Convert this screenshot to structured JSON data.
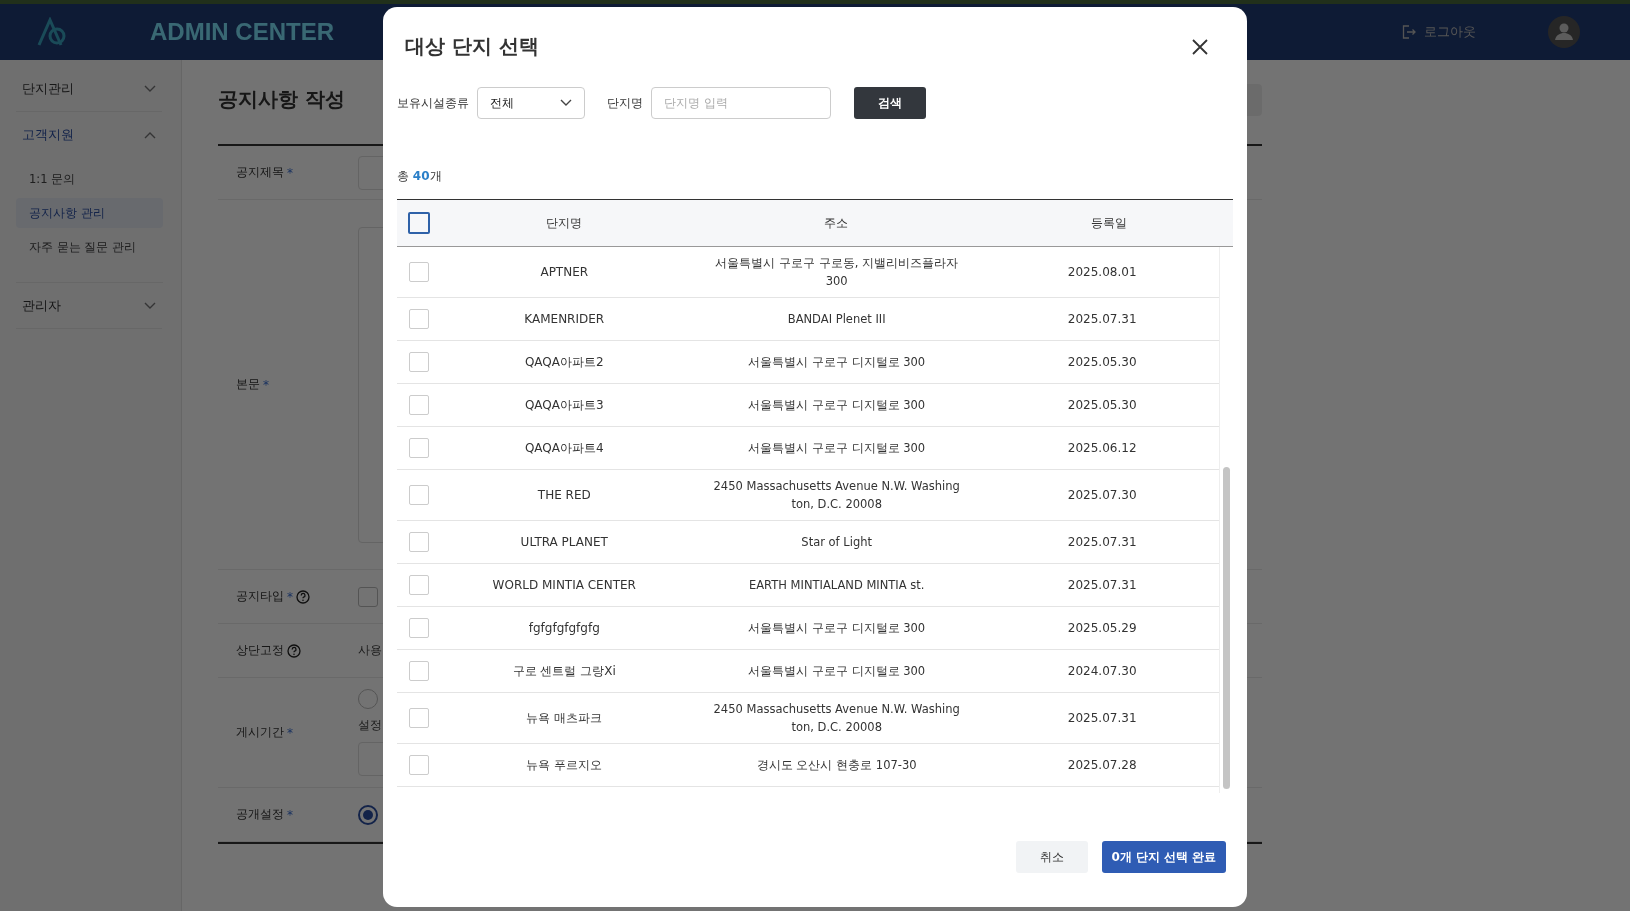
{
  "header": {
    "logo_text": "ADMIN CENTER",
    "logout": "로그아웃"
  },
  "sidebar": {
    "items": [
      {
        "label": "단지관리",
        "expanded": false
      },
      {
        "label": "고객지원",
        "expanded": true,
        "children": [
          {
            "label": "1:1 문의",
            "selected": false
          },
          {
            "label": "공지사항 관리",
            "selected": true
          },
          {
            "label": "자주 묻는 질문 관리",
            "selected": false
          }
        ]
      },
      {
        "label": "관리자",
        "expanded": false
      }
    ]
  },
  "page": {
    "title": "공지사항 작성",
    "fields": [
      {
        "label": "공지제목",
        "required_mark": "*",
        "help": false,
        "kind": "text"
      },
      {
        "label": "본문",
        "required_mark": "*",
        "help": false,
        "kind": "editor"
      },
      {
        "label": "공지타입",
        "required_mark": "*",
        "help": true,
        "kind": "checkbox",
        "checked": false
      },
      {
        "label": "상단고정",
        "help": true,
        "kind": "note",
        "value": "사용"
      },
      {
        "label": "게시기간",
        "required_mark": "*",
        "help": false,
        "kind": "period",
        "value": "설정",
        "selected": false
      },
      {
        "label": "공개설정",
        "required_mark": "*",
        "help": false,
        "kind": "radio",
        "selected": true
      }
    ]
  },
  "modal": {
    "title": "대상 단지 선택",
    "filters": {
      "facility_label": "보유시설종류",
      "facility_value": "전체",
      "name_label": "단지명",
      "name_placeholder": "단지명 입력",
      "search_button": "검색"
    },
    "total": {
      "prefix": "총",
      "count": "40",
      "suffix": "개"
    },
    "table": {
      "all_checked": false,
      "columns": [
        "단지명",
        "주소",
        "등록일"
      ],
      "rows": [
        {
          "checked": false,
          "name": "APTNER",
          "address": "서울특별시 구로구 구로동, 지밸리비즈플라자 300",
          "date": "2025.08.01"
        },
        {
          "checked": false,
          "name": "KAMENRIDER",
          "address": "BANDAI Plenet III",
          "date": "2025.07.31"
        },
        {
          "checked": false,
          "name": "QAQA아파트2",
          "address": "서울특별시 구로구 디지털로 300",
          "date": "2025.05.30"
        },
        {
          "checked": false,
          "name": "QAQA아파트3",
          "address": "서울특별시 구로구 디지털로 300",
          "date": "2025.05.30"
        },
        {
          "checked": false,
          "name": "QAQA아파트4",
          "address": "서울특별시 구로구 디지털로 300",
          "date": "2025.06.12"
        },
        {
          "checked": false,
          "name": "THE RED",
          "address": "2450 Massachusetts Avenue N.W. Washington, D.C. 20008",
          "date": "2025.07.30"
        },
        {
          "checked": false,
          "name": "ULTRA PLANET",
          "address": "Star of Light",
          "date": "2025.07.31"
        },
        {
          "checked": false,
          "name": "WORLD MINTIA CENTER",
          "address": "EARTH MINTIALAND MINTIA st.",
          "date": "2025.07.31"
        },
        {
          "checked": false,
          "name": "fgfgfgfgfgfg",
          "address": "서울특별시 구로구 디지털로 300",
          "date": "2025.05.29"
        },
        {
          "checked": false,
          "name": "구로 센트럴 그랑Xi",
          "address": "서울특별시 구로구 디지털로 300",
          "date": "2024.07.30"
        },
        {
          "checked": false,
          "name": "뉴욕 매츠파크",
          "address": "2450 Massachusetts Avenue N.W. Washington, D.C. 20008",
          "date": "2025.07.31"
        },
        {
          "checked": false,
          "name": "뉴욕 푸르지오",
          "address": "경시도 오산시 현충로 107-30",
          "date": "2025.07.28"
        }
      ]
    },
    "buttons": {
      "cancel": "취소",
      "confirm": "0개 단지 선택 완료"
    }
  }
}
